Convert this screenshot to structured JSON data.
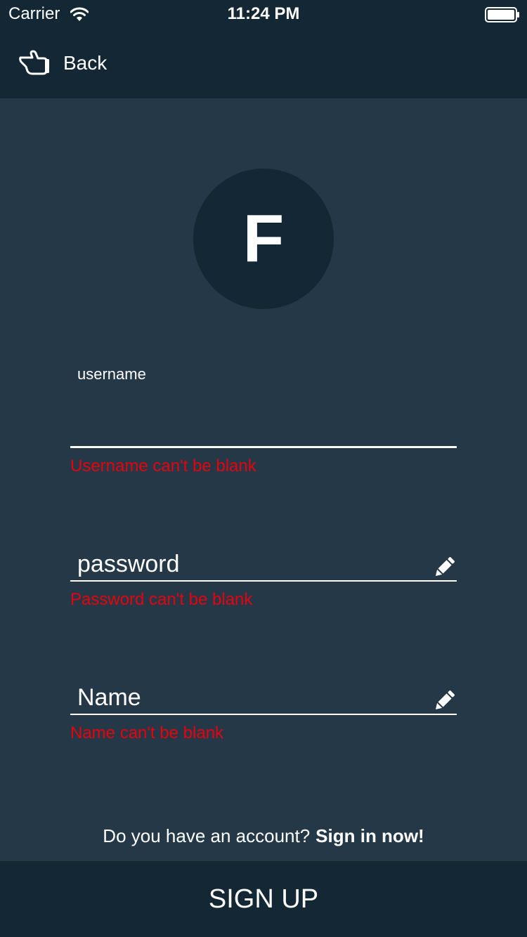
{
  "status_bar": {
    "carrier": "Carrier",
    "time": "11:24 PM",
    "wifi_icon": "wifi-icon",
    "battery_icon": "battery-icon"
  },
  "nav": {
    "back_icon": "pointing-hand-icon",
    "back_label": "Back"
  },
  "avatar": {
    "letter": "F",
    "background_color": "#142734"
  },
  "form": {
    "username": {
      "label": "username",
      "value": "",
      "error": "Username can't be blank"
    },
    "password": {
      "placeholder": "password",
      "value": "",
      "error": "Password can't be blank",
      "icon": "pencil-icon"
    },
    "name": {
      "placeholder": "Name",
      "value": "",
      "error": "Name can't be blank",
      "icon": "pencil-icon"
    }
  },
  "signin": {
    "prompt": "Do you have an account?",
    "link": "Sign in now!"
  },
  "signup_button": {
    "label": "SIGN UP"
  },
  "colors": {
    "background": "#243848",
    "bar_background": "#142734",
    "text": "#ffffff",
    "error": "#e8000d",
    "underline": "#ffffff"
  }
}
